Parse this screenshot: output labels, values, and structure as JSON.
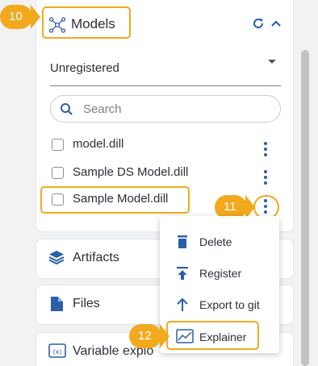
{
  "models": {
    "title": "Models",
    "dropdown_value": "Unregistered",
    "search_placeholder": "Search",
    "items": [
      {
        "label": "model.dill"
      },
      {
        "label": "Sample DS Model.dill"
      },
      {
        "label": "Sample Model.dill"
      }
    ]
  },
  "context_menu": {
    "items": [
      {
        "label": "Delete"
      },
      {
        "label": "Register"
      },
      {
        "label": "Export to git"
      },
      {
        "label": "Explainer"
      }
    ]
  },
  "sections": [
    {
      "label": "Artifacts"
    },
    {
      "label": "Files"
    },
    {
      "label": "Variable explo"
    }
  ],
  "callouts": {
    "b10": "10",
    "b11": "11",
    "b12": "12"
  },
  "colors": {
    "accent": "#2b5fa8",
    "highlight": "#f2a91e"
  }
}
